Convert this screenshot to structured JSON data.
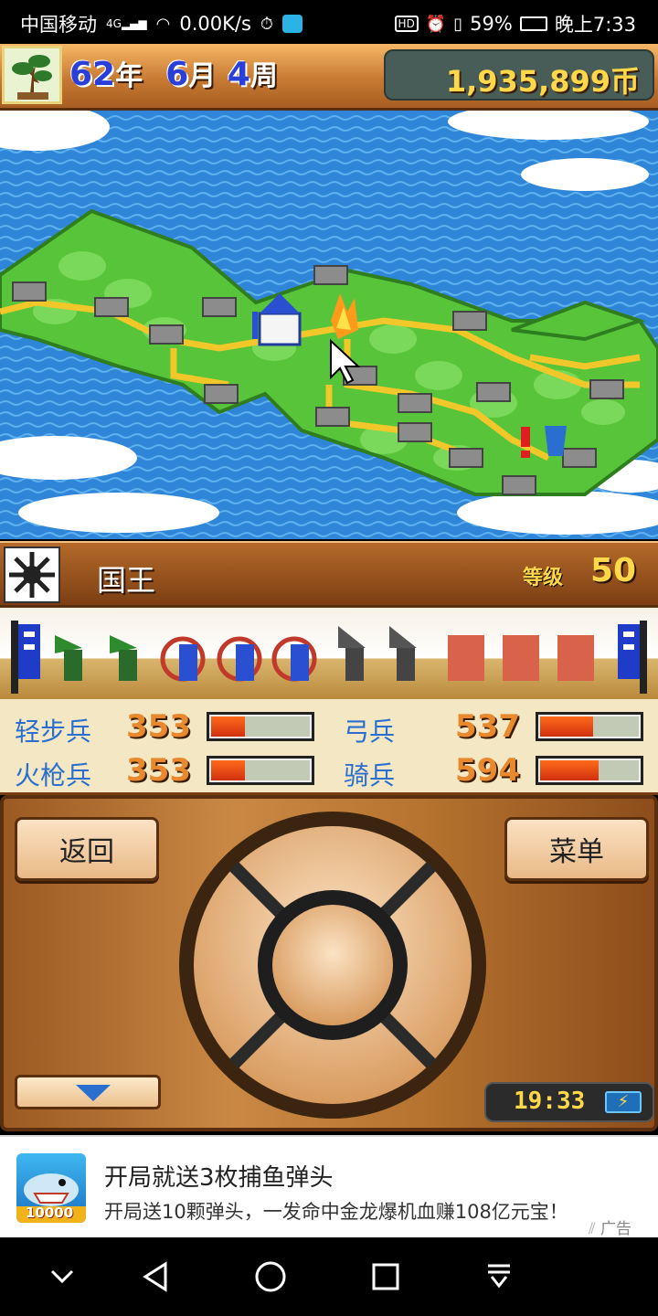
{
  "status_bar": {
    "carrier": "中国移动",
    "network": "4G",
    "speed": "0.00K/s",
    "battery": "59%",
    "time": "晚上7:33"
  },
  "hud": {
    "year_value": "62",
    "year_unit": "年",
    "month_value": "6",
    "month_unit": "月",
    "week_value": "4",
    "week_unit": "周",
    "coins": "1,935,899币"
  },
  "character": {
    "name": "国王",
    "level_label": "等级",
    "level_value": "50"
  },
  "stats": [
    {
      "label": "轻步兵",
      "value": "353",
      "fill": 0.35
    },
    {
      "label": "弓兵",
      "value": "537",
      "fill": 0.55
    },
    {
      "label": "火枪兵",
      "value": "353",
      "fill": 0.35
    },
    {
      "label": "骑兵",
      "value": "594",
      "fill": 0.6
    }
  ],
  "controls": {
    "back_label": "返回",
    "menu_label": "菜单",
    "clock": "19:33"
  },
  "ad": {
    "title": "开局就送3枚捕鱼弹头",
    "description": "开局送10颗弹头，一发命中金龙爆机血赚108亿元宝！",
    "tag": "广告",
    "thumb_text": "10000"
  },
  "colors": {
    "sea": "#2f86d8",
    "land": "#58c43a",
    "road": "#f2c72a",
    "wood": "#b5732f",
    "stat_label": "#2a6fd0",
    "stat_value": "#e9892d"
  }
}
